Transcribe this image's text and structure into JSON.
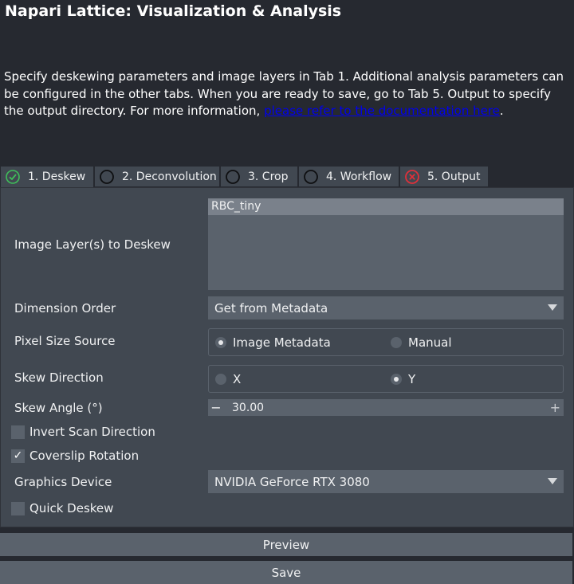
{
  "header": {
    "title": "Napari Lattice: Visualization & Analysis",
    "description_text": "Specify deskewing parameters and image layers in Tab 1.  Additional analysis parameters can be configured in the other tabs.  When you are ready to save, go to Tab 5.  Output to specify the output directory.  For more information, ",
    "doc_link": "please refer to the documentation here",
    "description_end": "."
  },
  "tabs": [
    {
      "label": "1. Deskew",
      "icon": "check-circle-icon",
      "status": "ok"
    },
    {
      "label": "2. Deconvolution",
      "icon": "empty-circle-icon",
      "status": "none"
    },
    {
      "label": "3. Crop",
      "icon": "empty-circle-icon",
      "status": "none"
    },
    {
      "label": "4. Workflow",
      "icon": "empty-circle-icon",
      "status": "none"
    },
    {
      "label": "5. Output",
      "icon": "error-circle-icon",
      "status": "error"
    }
  ],
  "deskew": {
    "image_layers_label": "Image Layer(s) to Deskew",
    "image_layers": [
      "RBC_tiny"
    ],
    "dimension_order_label": "Dimension Order",
    "dimension_order_value": "Get from Metadata",
    "pixel_size_label": "Pixel Size Source",
    "pixel_size_options": [
      "Image Metadata",
      "Manual"
    ],
    "pixel_size_selected": "Image Metadata",
    "skew_direction_label": "Skew Direction",
    "skew_direction_options": [
      "X",
      "Y"
    ],
    "skew_direction_selected": "Y",
    "skew_angle_label": "Skew Angle (°)",
    "skew_angle_value": "30.00",
    "minus_symbol": "−",
    "plus_symbol": "+",
    "invert_scan_label": "Invert Scan Direction",
    "invert_scan_checked": false,
    "coverslip_label": "Coverslip Rotation",
    "coverslip_checked": true,
    "graphics_device_label": "Graphics Device",
    "graphics_device_value": "NVIDIA GeForce RTX 3080",
    "quick_deskew_label": "Quick Deskew",
    "quick_deskew_checked": false
  },
  "buttons": {
    "preview": "Preview",
    "save": "Save"
  },
  "colors": {
    "background": "#262930",
    "panel": "#414851",
    "field": "#5a626c",
    "ok_green": "#3fbf5a",
    "error_red": "#e0303a"
  }
}
